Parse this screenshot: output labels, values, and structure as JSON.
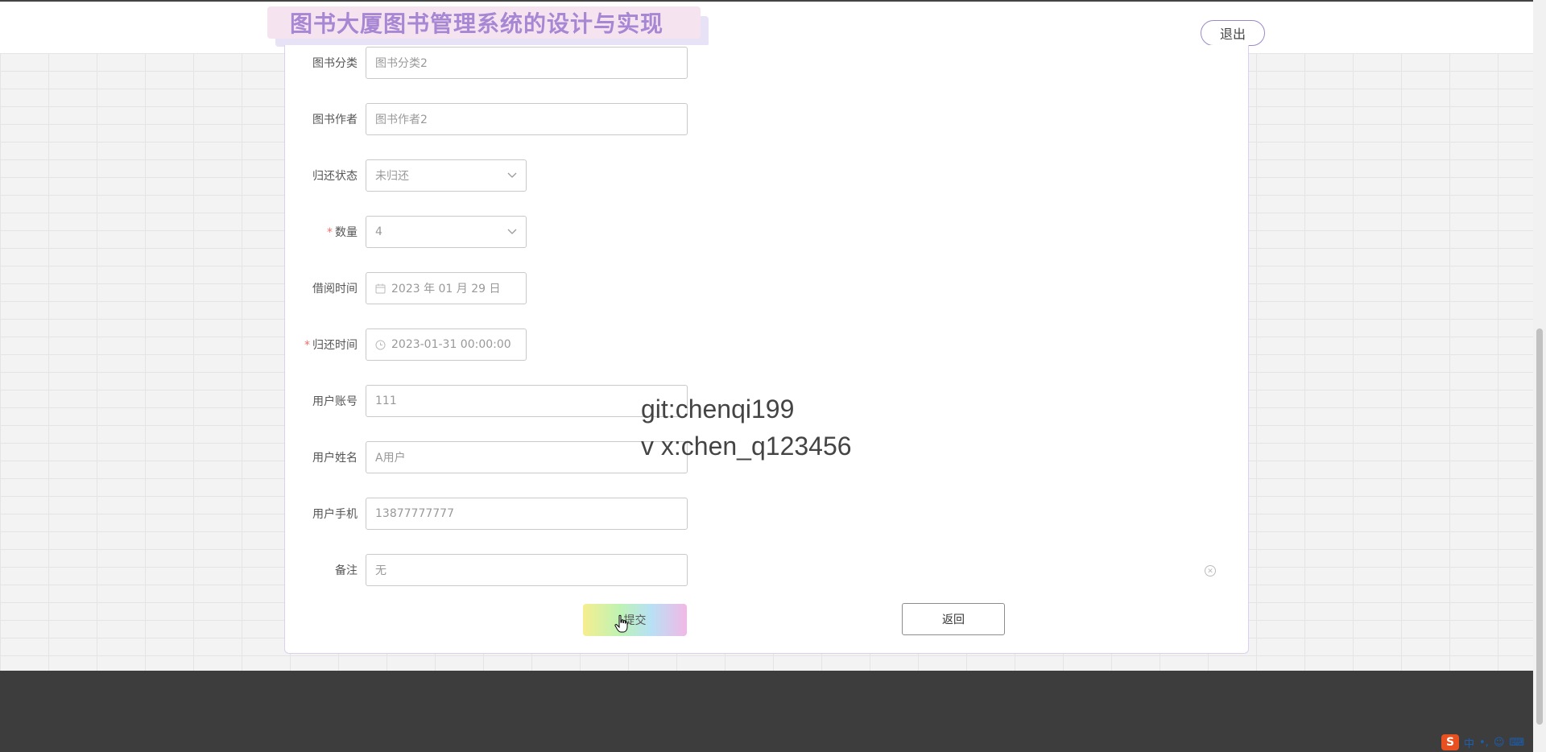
{
  "header": {
    "title": "图书大厦图书管理系统的设计与实现",
    "logout_label": "退出"
  },
  "form": {
    "fields": [
      {
        "label": "图书分类",
        "value": "图书分类2",
        "required": false,
        "type": "text"
      },
      {
        "label": "图书作者",
        "value": "图书作者2",
        "required": false,
        "type": "text"
      },
      {
        "label": "归还状态",
        "value": "未归还",
        "required": false,
        "type": "select"
      },
      {
        "label": "数量",
        "value": "4",
        "required": true,
        "type": "select"
      },
      {
        "label": "借阅时间",
        "value": "2023 年 01 月 29 日",
        "required": false,
        "type": "date"
      },
      {
        "label": "归还时间",
        "value": "2023-01-31 00:00:00",
        "required": true,
        "type": "datetime"
      },
      {
        "label": "用户账号",
        "value": "111",
        "required": false,
        "type": "text"
      },
      {
        "label": "用户姓名",
        "value": "A用户",
        "required": false,
        "type": "text"
      },
      {
        "label": "用户手机",
        "value": "13877777777",
        "required": false,
        "type": "text"
      },
      {
        "label": "备注",
        "value": "无",
        "required": false,
        "type": "text"
      }
    ],
    "required_mark": "*",
    "submit_label": "提交",
    "back_label": "返回"
  },
  "watermark": {
    "line1": "git:chenqi199",
    "line2": "v x:chen_q123456"
  },
  "tray": {
    "ime_logo": "S",
    "ime_mode": "中",
    "punct": "•,",
    "emoji_icon": "smile-icon",
    "keyboard_icon": "keyboard-icon"
  },
  "colors": {
    "title": "#a786d4",
    "footer": "#3d3d3d",
    "required": "#f56c6c",
    "logout_border": "#9c88c8"
  }
}
